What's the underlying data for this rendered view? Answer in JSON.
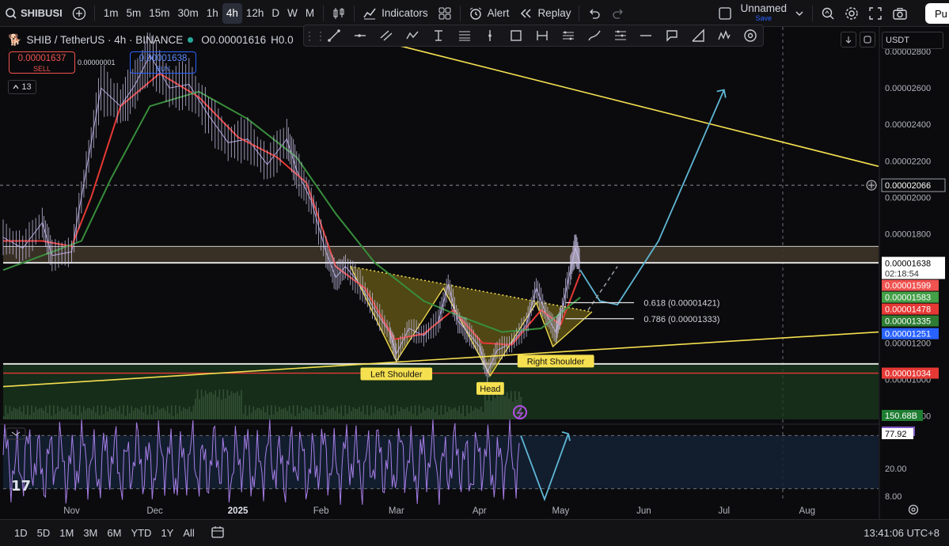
{
  "toolbar": {
    "symbol": "SHIBUSI",
    "timeframes": [
      "1m",
      "5m",
      "15m",
      "30m",
      "1h",
      "4h",
      "12h",
      "D",
      "W",
      "M"
    ],
    "active_timeframe": "4h",
    "indicators_label": "Indicators",
    "alert_label": "Alert",
    "replay_label": "Replay",
    "layout_name": "Unnamed",
    "layout_status": "Save",
    "publish_label": "Pu"
  },
  "legend": {
    "title": "SHIB / TetherUS · 4h · BINANCE",
    "ohlc_open": "O0.00001616",
    "ohlc_high": "H0.0",
    "sell_price": "0.00001637",
    "sell_label": "SELL",
    "buy_price": "0.00001638",
    "buy_label": "BUY",
    "spread": "0.00000001",
    "indicator_count": "13"
  },
  "price_axis": {
    "currency": "USDT",
    "labels": [
      {
        "v": "0.00002800",
        "p": 2.8e-05
      },
      {
        "v": "0.00002600",
        "p": 2.6e-05
      },
      {
        "v": "0.00002400",
        "p": 2.4e-05
      },
      {
        "v": "0.00002200",
        "p": 2.2e-05
      },
      {
        "v": "0.00002000",
        "p": 2e-05
      },
      {
        "v": "0.00001800",
        "p": 1.8e-05
      },
      {
        "v": "0.00001200",
        "p": 1.2e-05
      },
      {
        "v": "0.00001000",
        "p": 1e-05
      },
      {
        "v": "0.00000800",
        "p": 8e-06
      }
    ],
    "crosshair": "0.00002066",
    "badges": [
      {
        "v": "0.00001638",
        "p": 1.638e-05,
        "bg": "#ffffff",
        "fg": "#000000"
      },
      {
        "v": "0.00001599",
        "p": 1.599e-05,
        "bg": "#ef5350",
        "fg": "#ffffff"
      },
      {
        "v": "0.00001583",
        "p": 1.583e-05,
        "bg": "#43a047",
        "fg": "#ffffff"
      },
      {
        "v": "0.00001478",
        "p": 1.478e-05,
        "bg": "#e53935",
        "fg": "#ffffff"
      },
      {
        "v": "0.00001335",
        "p": 1.335e-05,
        "bg": "#2e7d32",
        "fg": "#ffffff"
      },
      {
        "v": "0.00001251",
        "p": 1.251e-05,
        "bg": "#2962ff",
        "fg": "#ffffff"
      },
      {
        "v": "0.00001034",
        "p": 1.034e-05,
        "bg": "#e53935",
        "fg": "#ffffff"
      }
    ],
    "countdown": "02:18:54",
    "volume_badge": "150.68B"
  },
  "time_axis": {
    "labels": [
      {
        "t": "Nov",
        "d": 2024.83
      },
      {
        "t": "Dec",
        "d": 2024.915
      },
      {
        "t": "2025",
        "d": 2025.0
      },
      {
        "t": "Feb",
        "d": 2025.085
      },
      {
        "t": "Mar",
        "d": 2025.162
      },
      {
        "t": "Apr",
        "d": 2025.247
      },
      {
        "t": "May",
        "d": 2025.33
      },
      {
        "t": "Jun",
        "d": 2025.415
      },
      {
        "t": "Jul",
        "d": 2025.497
      },
      {
        "t": "Aug",
        "d": 2025.582
      }
    ]
  },
  "chart_data": {
    "type": "line",
    "title": "SHIB / TetherUS · 4h · BINANCE",
    "x_range": [
      2024.76,
      2025.655
    ],
    "ylim": [
      7.8e-06,
      2.84e-05
    ],
    "series": [
      {
        "name": "",
        "color": "#b7a8e6",
        "points": [
          [
            2024.76,
            1.78e-05
          ],
          [
            2024.78,
            1.72e-05
          ],
          [
            2024.8,
            1.86e-05
          ],
          [
            2024.81,
            1.68e-05
          ],
          [
            2024.83,
            1.7e-05
          ],
          [
            2024.845,
            2.15e-05
          ],
          [
            2024.86,
            2.6e-05
          ],
          [
            2024.88,
            2.5e-05
          ],
          [
            2024.895,
            2.62e-05
          ],
          [
            2024.91,
            2.78e-05
          ],
          [
            2024.93,
            2.6e-05
          ],
          [
            2024.95,
            2.62e-05
          ],
          [
            2024.97,
            2.45e-05
          ],
          [
            2024.99,
            2.3e-05
          ],
          [
            2025.01,
            2.32e-05
          ],
          [
            2025.03,
            2.18e-05
          ],
          [
            2025.05,
            2.32e-05
          ],
          [
            2025.06,
            2.15e-05
          ],
          [
            2025.075,
            1.98e-05
          ],
          [
            2025.09,
            1.7e-05
          ],
          [
            2025.1,
            1.56e-05
          ],
          [
            2025.11,
            1.62e-05
          ],
          [
            2025.125,
            1.52e-05
          ],
          [
            2025.14,
            1.38e-05
          ],
          [
            2025.155,
            1.26e-05
          ],
          [
            2025.162,
            1.14e-05
          ],
          [
            2025.175,
            1.28e-05
          ],
          [
            2025.19,
            1.24e-05
          ],
          [
            2025.205,
            1.32e-05
          ],
          [
            2025.215,
            1.52e-05
          ],
          [
            2025.225,
            1.32e-05
          ],
          [
            2025.235,
            1.26e-05
          ],
          [
            2025.247,
            1.18e-05
          ],
          [
            2025.255,
            1.04e-05
          ],
          [
            2025.265,
            1.16e-05
          ],
          [
            2025.28,
            1.2e-05
          ],
          [
            2025.295,
            1.3e-05
          ],
          [
            2025.305,
            1.5e-05
          ],
          [
            2025.315,
            1.36e-05
          ],
          [
            2025.325,
            1.26e-05
          ],
          [
            2025.33,
            1.35e-05
          ],
          [
            2025.34,
            1.6e-05
          ],
          [
            2025.345,
            1.72e-05
          ],
          [
            2025.35,
            1.64e-05
          ]
        ]
      },
      {
        "name": "",
        "color": "#e53935",
        "points": [
          [
            2024.76,
            1.76e-05
          ],
          [
            2024.8,
            1.76e-05
          ],
          [
            2024.83,
            1.73e-05
          ],
          [
            2024.85,
            2e-05
          ],
          [
            2024.88,
            2.5e-05
          ],
          [
            2024.92,
            2.68e-05
          ],
          [
            2024.96,
            2.55e-05
          ],
          [
            2025.0,
            2.33e-05
          ],
          [
            2025.04,
            2.22e-05
          ],
          [
            2025.07,
            2.08e-05
          ],
          [
            2025.1,
            1.62e-05
          ],
          [
            2025.13,
            1.5e-05
          ],
          [
            2025.16,
            1.22e-05
          ],
          [
            2025.19,
            1.25e-05
          ],
          [
            2025.22,
            1.38e-05
          ],
          [
            2025.25,
            1.2e-05
          ],
          [
            2025.28,
            1.19e-05
          ],
          [
            2025.31,
            1.38e-05
          ],
          [
            2025.33,
            1.3e-05
          ],
          [
            2025.35,
            1.58e-05
          ]
        ]
      },
      {
        "name": "",
        "color": "#388e3c",
        "points": [
          [
            2024.76,
            1.6e-05
          ],
          [
            2024.8,
            1.68e-05
          ],
          [
            2024.84,
            1.76e-05
          ],
          [
            2024.87,
            2.1e-05
          ],
          [
            2024.91,
            2.5e-05
          ],
          [
            2024.96,
            2.58e-05
          ],
          [
            2025.01,
            2.43e-05
          ],
          [
            2025.06,
            2.22e-05
          ],
          [
            2025.1,
            1.91e-05
          ],
          [
            2025.14,
            1.64e-05
          ],
          [
            2025.19,
            1.43e-05
          ],
          [
            2025.23,
            1.34e-05
          ],
          [
            2025.27,
            1.26e-05
          ],
          [
            2025.31,
            1.28e-05
          ],
          [
            2025.35,
            1.45e-05
          ]
        ]
      }
    ],
    "levels": {
      "resistance_band": [
        1.64e-05,
        1.73e-05
      ],
      "resistance_line": 1.64e-05,
      "support_line": 1.085e-05,
      "red_line": 1.034e-05,
      "fib": [
        {
          "label": "0.618 (0.00001421)",
          "p": 1.421e-05
        },
        {
          "label": "0.786 (0.00001333)",
          "p": 1.333e-05
        }
      ]
    },
    "trendlines": {
      "upper": [
        [
          2025.115,
          2.9e-05
        ],
        [
          2025.655,
          2.17e-05
        ]
      ],
      "lower": [
        [
          2024.76,
          9.6e-06
        ],
        [
          2025.655,
          1.26e-05
        ]
      ],
      "neckline": [
        [
          2025.115,
          1.62e-05
        ],
        [
          2025.362,
          1.37e-05
        ]
      ]
    },
    "pattern": {
      "points": [
        [
          2025.115,
          1.62e-05
        ],
        [
          2025.162,
          1.1e-05
        ],
        [
          2025.21,
          1.5e-05
        ],
        [
          2025.258,
          1.02e-05
        ],
        [
          2025.305,
          1.42e-05
        ],
        [
          2025.322,
          1.18e-05
        ],
        [
          2025.362,
          1.37e-05
        ]
      ],
      "labels": [
        {
          "text": "Left Shoulder",
          "d": 2025.162,
          "p": 1.03e-05
        },
        {
          "text": "Head",
          "d": 2025.258,
          "p": 9.5e-06
        },
        {
          "text": "Right Shoulder",
          "d": 2025.325,
          "p": 1.1e-05
        }
      ]
    },
    "projection": [
      [
        2025.35,
        1.6e-05
      ],
      [
        2025.37,
        1.43e-05
      ],
      [
        2025.388,
        1.41e-05
      ],
      [
        2025.43,
        1.76e-05
      ],
      [
        2025.497,
        2.59e-05
      ]
    ],
    "projection_dashed": [
      [
        2025.358,
        1.38e-05
      ],
      [
        2025.388,
        1.62e-05
      ]
    ],
    "oscillator": {
      "value": "77.92",
      "prev_value": "82.23",
      "labels": [
        {
          "v": "20.00",
          "p": 20
        },
        {
          "v": "8.00",
          "p": 8
        }
      ],
      "upper_band": 80,
      "lower_band": 20
    }
  }
}
